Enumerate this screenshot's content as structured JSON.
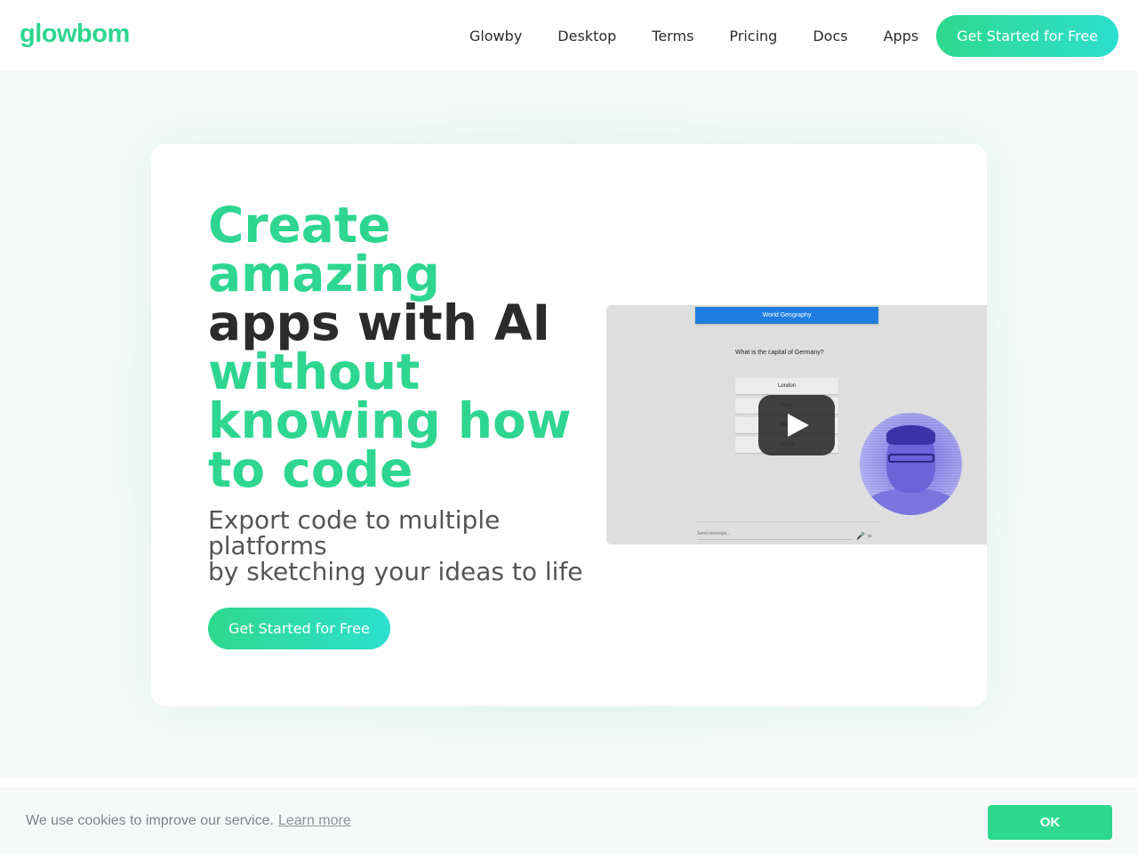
{
  "brand": {
    "logo": "glowbom",
    "accent": "#2ed68f",
    "accent_end": "#2ddfcf"
  },
  "nav": {
    "links": [
      "Glowby",
      "Desktop",
      "Terms",
      "Pricing",
      "Docs",
      "Apps"
    ],
    "cta": "Get Started for Free"
  },
  "hero": {
    "headline": {
      "line1": "Create",
      "line2": "amazing",
      "line3": "apps with AI",
      "line4": "without",
      "line5": "knowing how",
      "line6": "to code"
    },
    "subhead": {
      "line1": "Export code to multiple platforms",
      "line2": "by sketching your ideas to life"
    },
    "cta": "Get Started for Free"
  },
  "video": {
    "quiz_title": "World Geography",
    "question": "What is the capital of Germany?",
    "options": [
      "London",
      "Paris",
      "Berlin",
      "Lisbon"
    ],
    "send_placeholder": "Send message...",
    "play_icon": "play-icon",
    "mic_icon": "microphone-icon",
    "send_icon": "send-icon"
  },
  "cookie": {
    "message": "We use cookies to improve our service.",
    "link": "Learn more",
    "ok": "OK"
  }
}
